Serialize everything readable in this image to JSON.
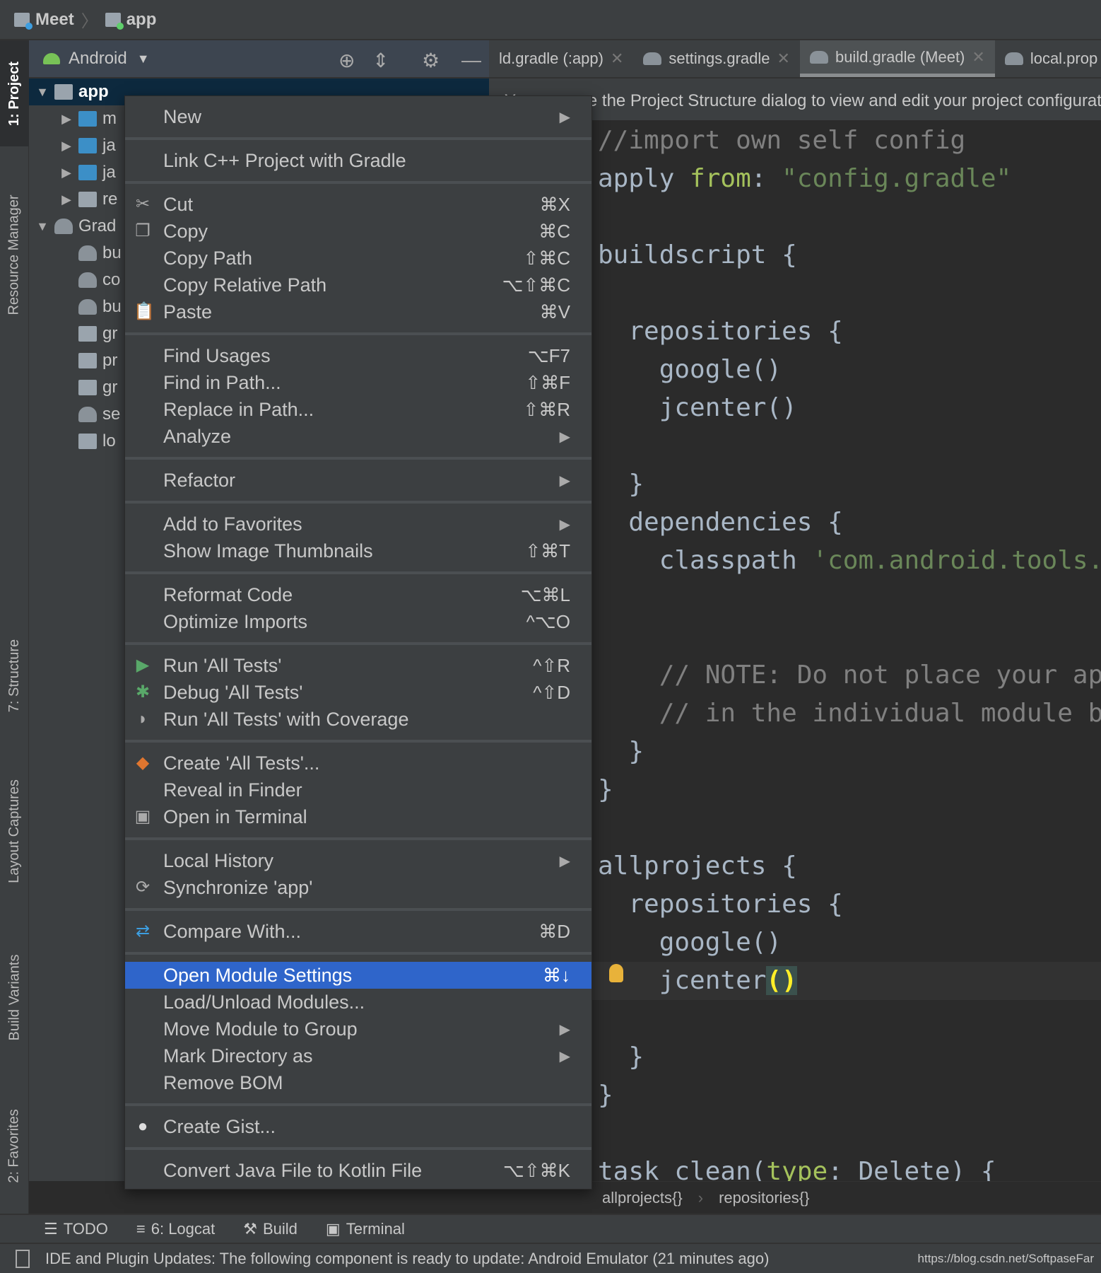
{
  "breadcrumb": [
    "Meet",
    "app"
  ],
  "colors": {
    "accent": "#2f65ca",
    "editor_bg": "#2b2b2b",
    "panel_bg": "#3c3f41",
    "keyword": "#cc7832",
    "string": "#6a8759",
    "comment": "#808080"
  },
  "project_panel": {
    "view": "Android",
    "icons": [
      "locate-icon",
      "collapse-icon",
      "gear-icon",
      "minimize-icon"
    ],
    "tree": [
      {
        "label": "app",
        "level": 0,
        "expanded": true,
        "icon": "module-folder",
        "selected": true
      },
      {
        "label": "m",
        "level": 1,
        "expanded": false,
        "icon": "folder"
      },
      {
        "label": "ja",
        "level": 1,
        "expanded": false,
        "icon": "folder"
      },
      {
        "label": "ja",
        "level": 1,
        "expanded": false,
        "icon": "folder"
      },
      {
        "label": "re",
        "level": 1,
        "expanded": false,
        "icon": "res-folder"
      },
      {
        "label": "Grad",
        "level": 0,
        "expanded": true,
        "icon": "gradle"
      },
      {
        "label": "bu",
        "level": 1,
        "icon": "gradle"
      },
      {
        "label": "co",
        "level": 1,
        "icon": "gradle"
      },
      {
        "label": "bu",
        "level": 1,
        "icon": "gradle"
      },
      {
        "label": "gr",
        "level": 1,
        "icon": "properties"
      },
      {
        "label": "pr",
        "level": 1,
        "icon": "file"
      },
      {
        "label": "gr",
        "level": 1,
        "icon": "properties"
      },
      {
        "label": "se",
        "level": 1,
        "icon": "gradle"
      },
      {
        "label": "lo",
        "level": 1,
        "icon": "properties"
      }
    ]
  },
  "left_strip": [
    "1: Project",
    "Resource Manager",
    "7: Structure",
    "Layout Captures",
    "Build Variants",
    "2: Favorites"
  ],
  "tabs": [
    {
      "label": "ld.gradle (:app)"
    },
    {
      "label": "settings.gradle"
    },
    {
      "label": "build.gradle (Meet)",
      "active": true
    },
    {
      "label": "local.prop"
    }
  ],
  "banner": "You can use the Project Structure dialog to view and edit your project configuration",
  "code": [
    [
      [
        "//import own self config",
        "cm"
      ]
    ],
    [
      [
        "apply ",
        "nm"
      ],
      [
        "from",
        "kv"
      ],
      [
        ": ",
        "nm"
      ],
      [
        "\"config.gradle\"",
        "st"
      ]
    ],
    [],
    [
      [
        "buildscript {",
        "nm"
      ]
    ],
    [],
    [
      [
        "  repositories {",
        "nm"
      ]
    ],
    [
      [
        "    google()",
        "nm"
      ]
    ],
    [
      [
        "    jcenter()",
        "nm"
      ]
    ],
    [],
    [
      [
        "  }",
        "nm"
      ]
    ],
    [
      [
        "  dependencies {",
        "nm"
      ]
    ],
    [
      [
        "    classpath ",
        "nm"
      ],
      [
        "'com.android.tools.build:gradle'",
        "st"
      ]
    ],
    [],
    [],
    [
      [
        "    // NOTE: Do not place your application dependencies here",
        "cm"
      ]
    ],
    [
      [
        "    // in the individual module build.gradle files",
        "cm"
      ]
    ],
    [
      [
        "  }",
        "nm"
      ]
    ],
    [
      [
        "}",
        "nm"
      ]
    ],
    [],
    [
      [
        "allprojects {",
        "nm"
      ]
    ],
    [
      [
        "  repositories {",
        "nm"
      ]
    ],
    [
      [
        "    google()",
        "nm"
      ]
    ],
    [
      [
        "    jcenter",
        "nm"
      ],
      [
        "()",
        "br"
      ]
    ],
    [],
    [
      [
        "  }",
        "nm"
      ]
    ],
    [
      [
        "}",
        "nm"
      ]
    ],
    [],
    [
      [
        "task clean(",
        "nm"
      ],
      [
        "type",
        "kv"
      ],
      [
        ": Delete) {",
        "nm"
      ]
    ]
  ],
  "current_line": 22,
  "editor_breadcrumb": [
    "allprojects{}",
    "repositories{}"
  ],
  "menu": [
    [
      {
        "label": "New",
        "submenu": true
      }
    ],
    [
      {
        "label": "Link C++ Project with Gradle"
      }
    ],
    [
      {
        "label": "Cut",
        "shortcut": "⌘X",
        "icon": "scissors-icon"
      },
      {
        "label": "Copy",
        "shortcut": "⌘C",
        "icon": "copy-icon"
      },
      {
        "label": "Copy Path",
        "shortcut": "⇧⌘C"
      },
      {
        "label": "Copy Relative Path",
        "shortcut": "⌥⇧⌘C"
      },
      {
        "label": "Paste",
        "shortcut": "⌘V",
        "icon": "paste-icon"
      }
    ],
    [
      {
        "label": "Find Usages",
        "shortcut": "⌥F7"
      },
      {
        "label": "Find in Path...",
        "shortcut": "⇧⌘F"
      },
      {
        "label": "Replace in Path...",
        "shortcut": "⇧⌘R"
      },
      {
        "label": "Analyze",
        "submenu": true
      }
    ],
    [
      {
        "label": "Refactor",
        "submenu": true
      }
    ],
    [
      {
        "label": "Add to Favorites",
        "submenu": true
      },
      {
        "label": "Show Image Thumbnails",
        "shortcut": "⇧⌘T"
      }
    ],
    [
      {
        "label": "Reformat Code",
        "shortcut": "⌥⌘L"
      },
      {
        "label": "Optimize Imports",
        "shortcut": "^⌥O"
      }
    ],
    [
      {
        "label": "Run 'All Tests'",
        "shortcut": "^⇧R",
        "icon": "run-icon"
      },
      {
        "label": "Debug 'All Tests'",
        "shortcut": "^⇧D",
        "icon": "debug-icon"
      },
      {
        "label": "Run 'All Tests' with Coverage",
        "icon": "coverage-icon"
      }
    ],
    [
      {
        "label": "Create 'All Tests'...",
        "icon": "create-test-icon"
      },
      {
        "label": "Reveal in Finder"
      },
      {
        "label": "Open in Terminal",
        "icon": "terminal-icon"
      }
    ],
    [
      {
        "label": "Local History",
        "submenu": true
      },
      {
        "label": "Synchronize 'app'",
        "icon": "sync-icon"
      }
    ],
    [
      {
        "label": "Compare With...",
        "shortcut": "⌘D",
        "icon": "compare-icon"
      }
    ],
    [
      {
        "label": "Open Module Settings",
        "shortcut": "⌘↓",
        "selected": true
      },
      {
        "label": "Load/Unload Modules..."
      },
      {
        "label": "Move Module to Group",
        "submenu": true
      },
      {
        "label": "Mark Directory as",
        "submenu": true
      },
      {
        "label": "Remove BOM"
      }
    ],
    [
      {
        "label": "Create Gist...",
        "icon": "github-icon"
      }
    ],
    [
      {
        "label": "Convert Java File to Kotlin File",
        "shortcut": "⌥⇧⌘K"
      }
    ]
  ],
  "bottom_tools": [
    {
      "label": "TODO",
      "icon": "list-icon"
    },
    {
      "label": "6: Logcat",
      "icon": "logcat-icon"
    },
    {
      "label": "Build",
      "icon": "hammer-icon"
    },
    {
      "label": "Terminal",
      "icon": "terminal-icon"
    }
  ],
  "status": {
    "message": "IDE and Plugin Updates: The following component is ready to update: Android Emulator (21 minutes ago)",
    "watermark": "https://blog.csdn.net/SoftpaseFar"
  }
}
